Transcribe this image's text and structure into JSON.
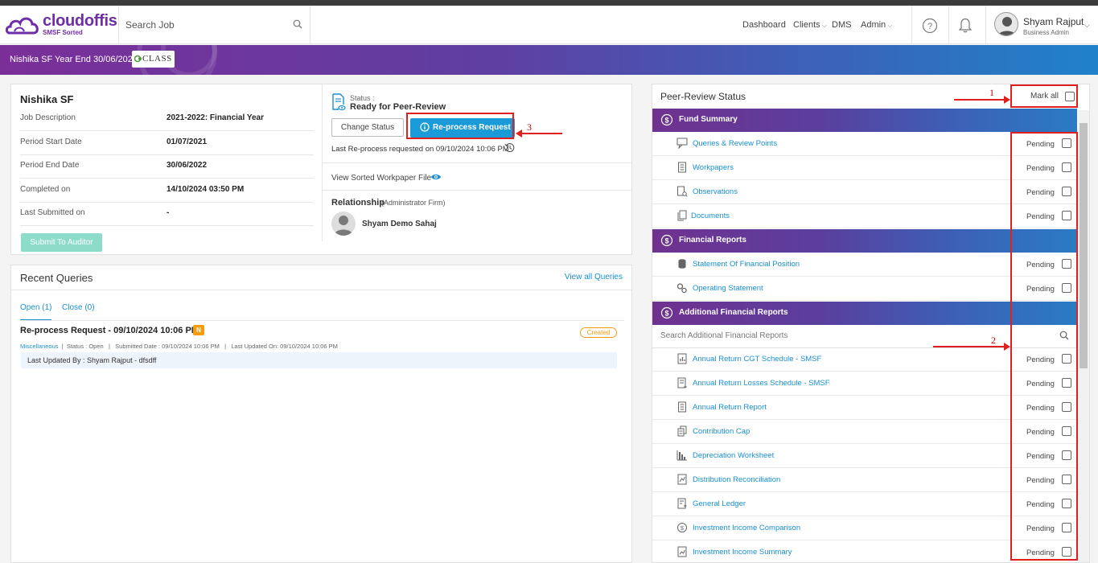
{
  "brand": {
    "name": "cloudoffis",
    "tagline": "SMSF Sorted"
  },
  "search": {
    "placeholder": "Search Job"
  },
  "nav": {
    "dashboard": "Dashboard",
    "clients": "Clients",
    "dms": "DMS",
    "admin": "Admin"
  },
  "user": {
    "name": "Shyam Rajput",
    "role": "Business Admin"
  },
  "banner": {
    "title": "Nishika SF Year End 30/06/2022",
    "partner_logo": "CLASS"
  },
  "job": {
    "title": "Nishika SF",
    "details": [
      {
        "label": "Job Description",
        "value": "2021-2022: Financial Year"
      },
      {
        "label": "Period Start Date",
        "value": "01/07/2021"
      },
      {
        "label": "Period End Date",
        "value": "30/06/2022"
      },
      {
        "label": "Completed on",
        "value": "14/10/2024 03:50 PM"
      },
      {
        "label": "Last Submitted on",
        "value": "-"
      }
    ],
    "submit_label": "Submit To Auditor",
    "status_label": "Status :",
    "status_value": "Ready for Peer-Review",
    "change_status_label": "Change Status",
    "reprocess_label": "Re-process Request",
    "last_reprocess": "Last Re-process requested on 09/10/2024 10:06 PM",
    "view_sorted": "View Sorted Workpaper File",
    "relationship_title": "Relationship",
    "relationship_sub": "(Administrator Firm)",
    "relationship_name": "Shyam Demo Sahaj"
  },
  "queries": {
    "title": "Recent Queries",
    "view_all": "View all Queries",
    "tab_open": "Open (1)",
    "tab_close": "Close (0)",
    "item": {
      "title": "Re-process Request - 09/10/2024 10:06 PM",
      "badge": "N",
      "status_pill": "Created",
      "category": "Miscellaneous",
      "status": "Status : Open",
      "submitted": "Submitted Date : 09/10/2024 10:06 PM",
      "updated": "Last Updated On: 09/10/2024 10:06 PM",
      "last_updated_by": "Last Updated By : Shyam Rajput - dfsdff"
    }
  },
  "peer_review": {
    "title": "Peer-Review Status",
    "mark_all": "Mark all",
    "search_placeholder": "Search Additional Financial Reports",
    "sections": [
      {
        "title": "Fund Summary",
        "items": [
          {
            "label": "Queries & Review Points",
            "status": "Pending"
          },
          {
            "label": "Workpapers",
            "status": "Pending"
          },
          {
            "label": "Observations",
            "status": "Pending"
          },
          {
            "label": "Documents",
            "status": "Pending"
          }
        ]
      },
      {
        "title": "Financial Reports",
        "items": [
          {
            "label": "Statement Of Financial Position",
            "status": "Pending"
          },
          {
            "label": "Operating Statement",
            "status": "Pending"
          }
        ]
      },
      {
        "title": "Additional Financial Reports",
        "items": [
          {
            "label": "Annual Return CGT Schedule - SMSF",
            "status": "Pending"
          },
          {
            "label": "Annual Return Losses Schedule - SMSF",
            "status": "Pending"
          },
          {
            "label": "Annual Return Report",
            "status": "Pending"
          },
          {
            "label": "Contribution Cap",
            "status": "Pending"
          },
          {
            "label": "Depreciation Worksheet",
            "status": "Pending"
          },
          {
            "label": "Distribution Reconciliation",
            "status": "Pending"
          },
          {
            "label": "General Ledger",
            "status": "Pending"
          },
          {
            "label": "Investment Income Comparison",
            "status": "Pending"
          },
          {
            "label": "Investment Income Summary",
            "status": "Pending"
          }
        ]
      }
    ]
  },
  "annotations": {
    "n1": "1",
    "n2": "2",
    "n3": "3"
  },
  "colors": {
    "brand_purple": "#6f2da8",
    "link_blue": "#1a8fd0",
    "primary_button": "#1a9ad6",
    "annotation_red": "#e02020",
    "pending_badge": "#f39c12"
  }
}
